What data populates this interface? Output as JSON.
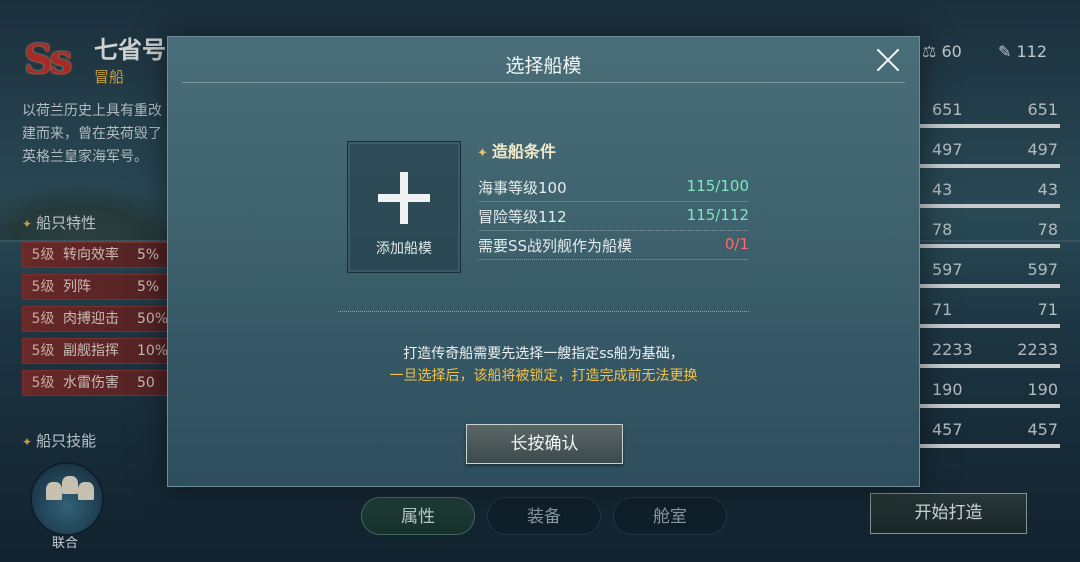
{
  "ship": {
    "grade": "Ss",
    "name": "七省号",
    "class": "冒船",
    "description": "以荷兰历史上具有重改建而来，曾在英荷毁了英格兰皇家海军号。"
  },
  "traits": {
    "title": "船只特性",
    "items": [
      {
        "level": "5级",
        "name": "转向效率",
        "value": "5%"
      },
      {
        "level": "5级",
        "name": "列阵",
        "value": "5%"
      },
      {
        "level": "5级",
        "name": "肉搏迎击",
        "value": "50%"
      },
      {
        "level": "5级",
        "name": "副舰指挥",
        "value": "10%"
      },
      {
        "level": "5级",
        "name": "水雷伤害",
        "value": "50"
      }
    ]
  },
  "skills": {
    "title": "船只技能",
    "skill_label": "联合"
  },
  "top_stats": {
    "balance": "60",
    "power": "112"
  },
  "stats": [
    {
      "a": "651",
      "b": "651"
    },
    {
      "a": "497",
      "b": "497"
    },
    {
      "a": "43",
      "b": "43"
    },
    {
      "a": "78",
      "b": "78"
    },
    {
      "a": "597",
      "b": "597"
    },
    {
      "a": "71",
      "b": "71"
    },
    {
      "a": "2233",
      "b": "2233"
    },
    {
      "a": "190",
      "b": "190"
    },
    {
      "a": "457",
      "b": "457"
    }
  ],
  "tabs": [
    "属性",
    "装备",
    "舱室"
  ],
  "start_button": "开始打造",
  "modal": {
    "title": "选择船模",
    "add_label": "添加船模",
    "conditions_title": "造船条件",
    "conditions": [
      {
        "label": "海事等级100",
        "value": "115/100",
        "status": "ok"
      },
      {
        "label": "冒险等级112",
        "value": "115/112",
        "status": "ok"
      },
      {
        "label": "需要SS战列舰作为船模",
        "value": "0/1",
        "status": "bad"
      }
    ],
    "note_line1": "打造传奇船需要先选择一艘指定ss船为基础，",
    "note_line2": "一旦选择后，该船将被锁定，打造完成前无法更换",
    "confirm_button": "长按确认"
  },
  "colors": {
    "ok": "#7fe6c2",
    "bad": "#ff6a6a",
    "warning_text": "#f0c24a",
    "grade_red": "#c2302a"
  }
}
